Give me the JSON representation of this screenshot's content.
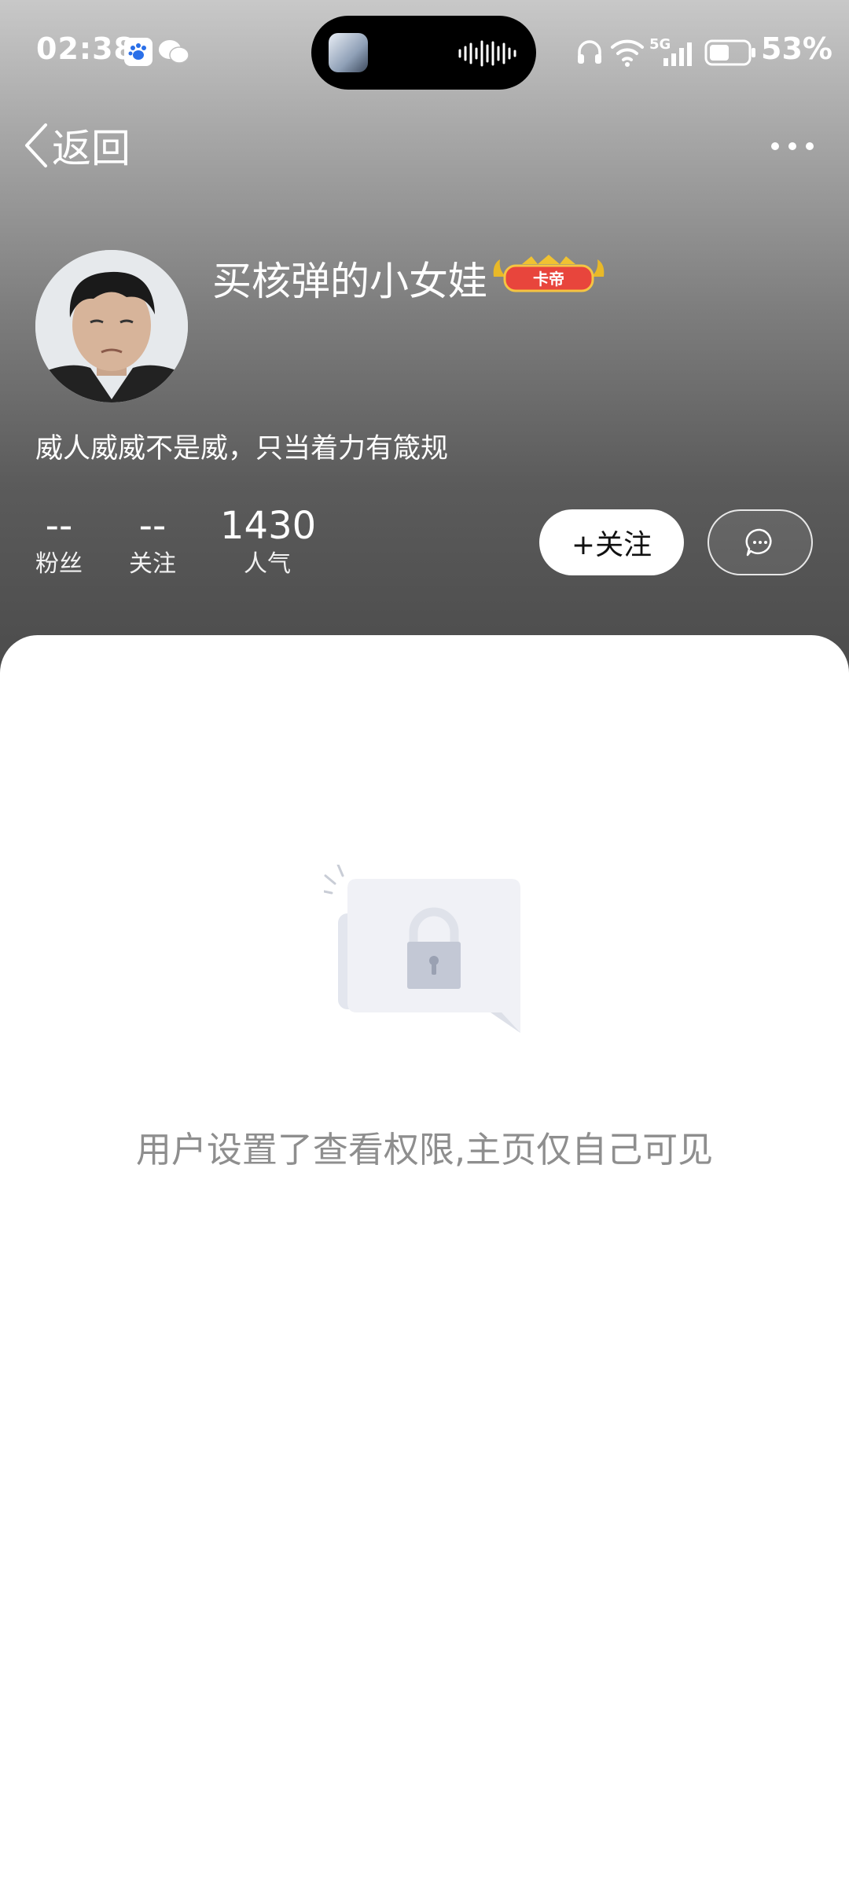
{
  "status_bar": {
    "time": "02:38",
    "network": "5G",
    "battery": "53%"
  },
  "nav": {
    "back_label": "返回"
  },
  "profile": {
    "username": "买核弹的小女娃",
    "badge_text": "卡帝",
    "bio": "威人威威不是威，只当着力有箴规",
    "stats": [
      {
        "value": "--",
        "label": "粉丝"
      },
      {
        "value": "--",
        "label": "关注"
      },
      {
        "value": "1430",
        "label": "人气"
      }
    ],
    "follow_label": "+关注"
  },
  "content": {
    "empty_message": "用户设置了查看权限,主页仅自己可见"
  },
  "colors": {
    "header_top": "#c8c8c8",
    "header_bottom": "#4a4a4a",
    "empty_text": "#8e8e8e",
    "badge": "#e8453c"
  },
  "icons": [
    "baidu-icon",
    "wechat-icon",
    "headphones-icon",
    "wifi-icon",
    "signal-icon",
    "battery-icon",
    "back-chevron-icon",
    "more-icon",
    "message-icon",
    "lock-icon"
  ]
}
